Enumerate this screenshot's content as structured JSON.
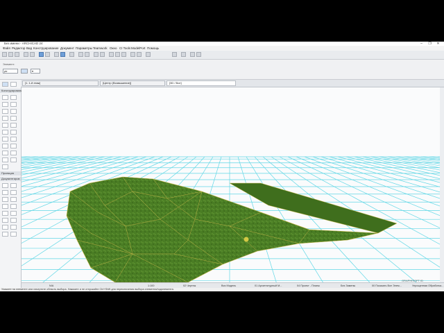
{
  "app": {
    "title": "Без имени - ARCHICAD 24",
    "window_controls": [
      "–",
      "❐",
      "✕"
    ]
  },
  "menu": [
    "Файл",
    "Редактор",
    "Вид",
    "Конструирование",
    "Документ",
    "Параметры",
    "Teamwork",
    "Окно",
    "CI Tools",
    "ModelPort",
    "Помощь"
  ],
  "info_box": {
    "label": "Элемент:",
    "fields": [
      "ptr",
      "▾"
    ]
  },
  "toolbox": {
    "sections": [
      "Конструирование",
      "Проекция",
      "Документиров"
    ],
    "select_label": "▸"
  },
  "view_tabs": [
    {
      "label": "[1. 1-й этаж]"
    },
    {
      "label": "[Центр (Возвышение)]"
    },
    {
      "label": "[3D / Все]"
    }
  ],
  "status": {
    "zoom": "N/A",
    "scale": "1:100",
    "items": [
      "02 Чертеж",
      "Вся Модель",
      "01 Архитектурный М...",
      "04 Проект - Планы",
      "Без Замены",
      "00 Показать Все Элем...",
      "Упрощенная Обработка..."
    ]
  },
  "message": "Укажите на элементе или начертите область выбора. Нажмите и не отпускайте Ctrl+Shift для переключения выбора элемента/подэлемента.",
  "watermark": "GRAPHISOFT ID",
  "colors": {
    "terrain": "#4a7d24",
    "grid": "#4fd3e3",
    "mesh_line": "#c9b84a",
    "flat_patch": "#3f6e1d"
  }
}
